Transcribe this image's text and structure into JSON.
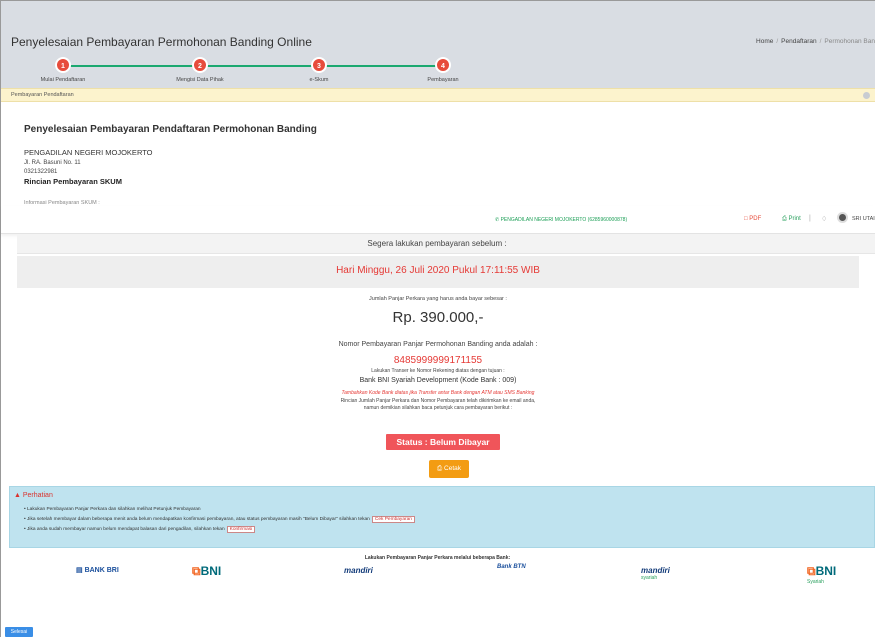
{
  "header": {
    "title": "Penyelesaian Pembayaran Permohonan Banding Online",
    "breadcrumb": [
      "Home",
      "Pendaftaran",
      "Permohonan Ban"
    ]
  },
  "steps": [
    {
      "num": "1",
      "label": "Mulai Pendaftaran"
    },
    {
      "num": "2",
      "label": "Mengisi Data Pihak"
    },
    {
      "num": "3",
      "label": "e-Skum"
    },
    {
      "num": "4",
      "label": "Pembayaran"
    }
  ],
  "notice": {
    "label": "Pembayaran Pendaftaran"
  },
  "court": {
    "heading": "Penyelesaian Pembayaran Pendaftaran Permohonan Banding",
    "name": "PENGADILAN NEGERI MOJOKERTO",
    "address": "Jl. RA. Basuni No. 11",
    "phone": "0321322981",
    "rincian": "Rincian Pembayaran SKUM",
    "ghost": "Informasi Pembayaran SKUM :"
  },
  "toolbar": {
    "court_link": "PENGADILAN NEGERI MOJOKERTO (6285960000878)",
    "pdf": "PDF",
    "print": "Print",
    "user": "SRI UTAI"
  },
  "payment": {
    "before_text": "Segera lakukan pembayaran sebelum :",
    "deadline": "Hari Minggu, 26 Juli 2020 Pukul 17:11:55 WIB",
    "amount_label": "Jumlah Panjar Perkara yang harus anda bayar sebesar :",
    "amount": "Rp. 390.000,-",
    "number_label": "Nomor Pembayaran Panjar Permohonan Banding anda adalah :",
    "number": "8485999999171155",
    "transfer_label": "Lakukan Transer ke Nomor Rekening diatas dengan tujuan :",
    "bank": "Bank BNI Syariah Development (Kode Bank : 009)",
    "bank_note": "Tambahkan Kode Bank diatas jika Transfer antar Bank dengan ATM atau SMS Banking",
    "email_note_1": "Rincian Jumlah Panjar Perkara dan Nomor Pembayaran telah dikirimkan ke email anda,",
    "email_note_2": "namun demikian silahkan baca petunjuk cara pembayaran berikut :",
    "status": "Status : Belum Dibayar",
    "cetak": "Cetak"
  },
  "alert": {
    "title": "Perhatian",
    "item1": "Lakukan Pembayaran Panjar Perkara dan silahkan melihat Petunjuk Pembayaran",
    "item2": "Jika setelah membayar dalam beberapa menit anda belum mendapatkan konfirmasi pembayaran, atau status pembayaran masih \"Belum Dibayar\" silahkan tekan",
    "item2_button": "Cek Pembayaran",
    "item3": "Jika anda sudah membayar namun belum mendapat balasan dari pengadilan, silahkan tekan",
    "item3_button": "Konfirmasi"
  },
  "banks": {
    "title": "Lakukan Pembayaran Panjar Perkara melalui beberapa Bank:",
    "bri": "BANK BRI",
    "bni": "BNI",
    "mandiri": "mandiri",
    "btn": "Bank BTN",
    "mandiri_syariah": "syariah",
    "bni_syariah": "Syariah"
  },
  "footer": {
    "selesai": "Selesai"
  }
}
